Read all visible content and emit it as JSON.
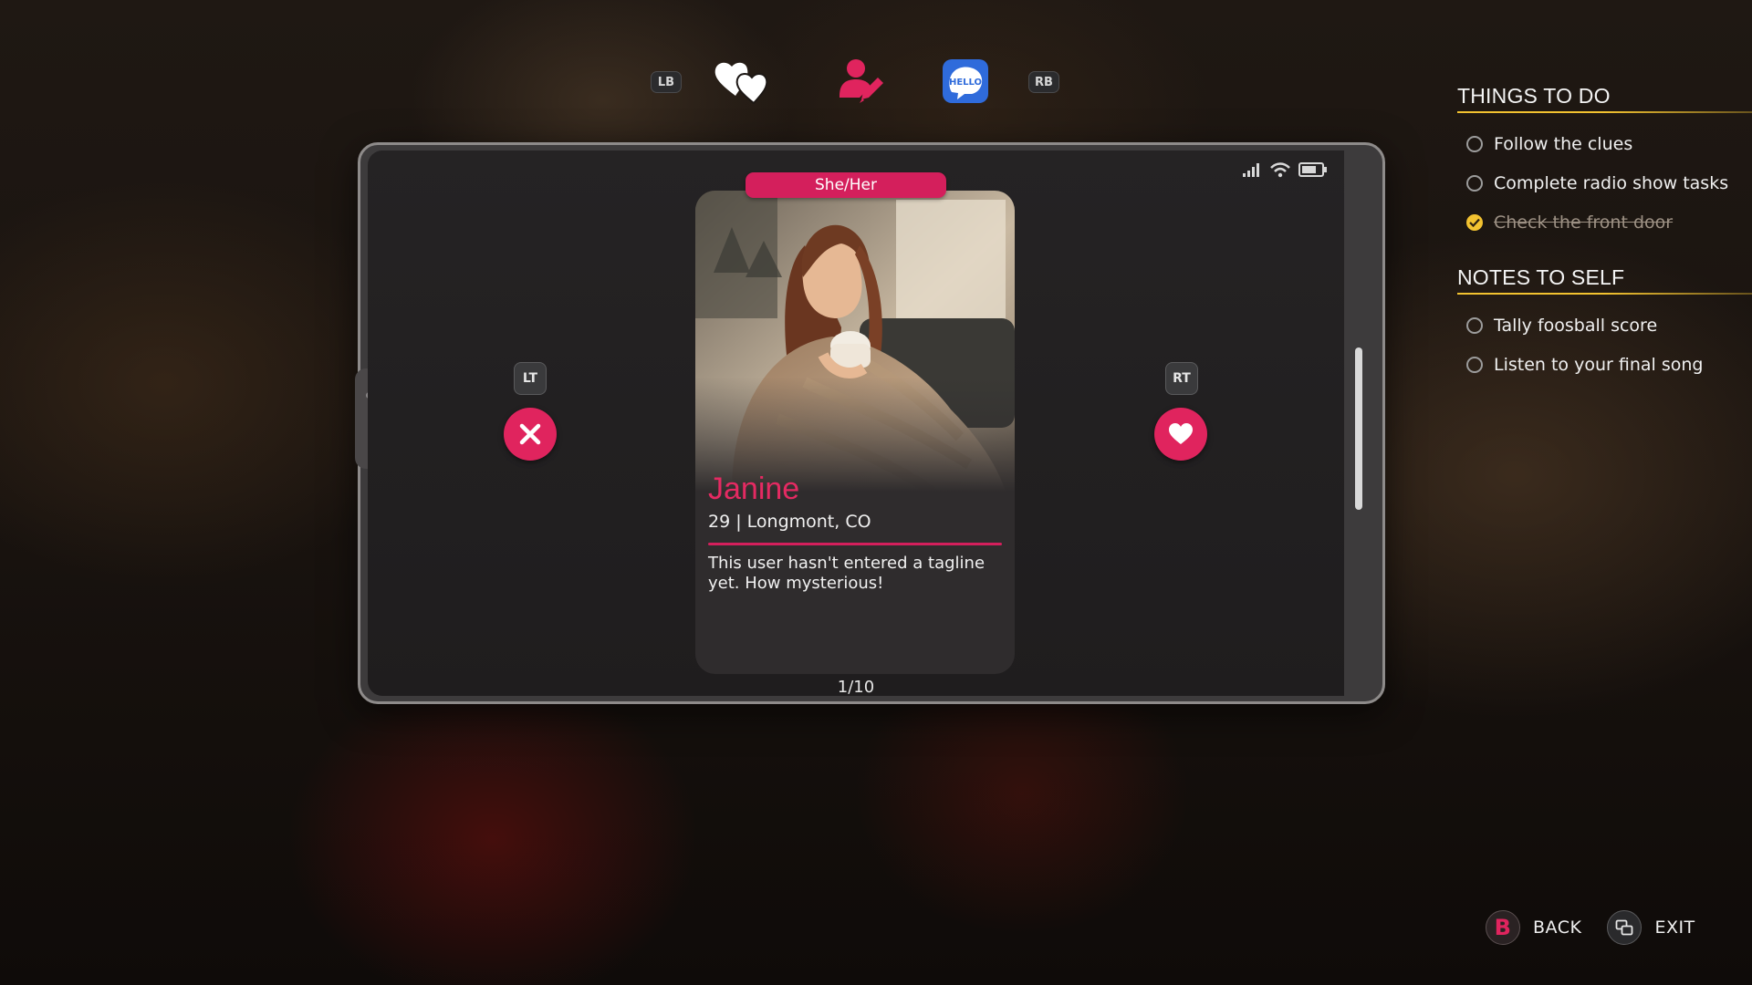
{
  "nav": {
    "lb": "LB",
    "rb": "RB",
    "tabs": [
      {
        "icon": "hearts-icon",
        "active": false
      },
      {
        "icon": "profile-edit-icon",
        "active": true
      },
      {
        "icon": "hello-chat-icon",
        "label": "HELLO",
        "active": false
      }
    ]
  },
  "phone": {
    "triggers": {
      "left": "LT",
      "right": "RT"
    },
    "card": {
      "pronouns": "She/Her",
      "name": "Janine",
      "age_location": "29 | Longmont, CO",
      "tagline": "This user hasn't entered a tagline yet. How mysterious!"
    },
    "counter": "1/10",
    "colors": {
      "accent": "#e0245e"
    }
  },
  "things_to_do": {
    "title": "THINGS TO DO",
    "items": [
      {
        "label": "Follow the clues",
        "done": false
      },
      {
        "label": "Complete radio show tasks",
        "done": false
      },
      {
        "label": "Check the front door",
        "done": true
      }
    ]
  },
  "notes_to_self": {
    "title": "NOTES TO SELF",
    "items": [
      {
        "label": "Tally foosball score",
        "done": false
      },
      {
        "label": "Listen to your final song",
        "done": false
      }
    ]
  },
  "footer": {
    "back_button": "B",
    "back_label": "BACK",
    "exit_label": "EXIT"
  },
  "colors": {
    "highlight": "#f2c230",
    "pink": "#d41f5c"
  }
}
